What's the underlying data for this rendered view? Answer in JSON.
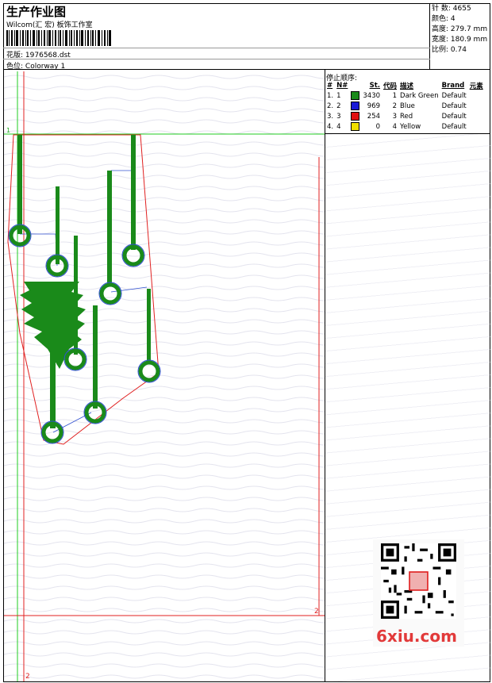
{
  "header": {
    "title": "生产作业图",
    "company": "Wilcom(汇 宏) 板饰工作室",
    "design_label": "花版:",
    "design_value": "1976568.dst",
    "colorway_label": "色位:",
    "colorway_value": "Colorway 1"
  },
  "specs": [
    {
      "label": "针 数:",
      "value": "4655"
    },
    {
      "label": "颜色:",
      "value": "4"
    },
    {
      "label": "高度:",
      "value": "279.7 mm"
    },
    {
      "label": "宽度:",
      "value": "180.9 mm"
    },
    {
      "label": "比例:",
      "value": "0.74"
    }
  ],
  "stop_sequence": {
    "title": "停止顺序:",
    "headers": [
      "#",
      "N#",
      "St.",
      "代码",
      "描述",
      "Brand",
      "元素"
    ],
    "rows": [
      {
        "index": "1.",
        "n": "1",
        "color": "#1a8a1a",
        "stitches": "3430",
        "code": "1",
        "desc": "Dark Green",
        "brand": "Default"
      },
      {
        "index": "2.",
        "n": "2",
        "color": "#1a1ad6",
        "stitches": "969",
        "code": "2",
        "desc": "Blue",
        "brand": "Default"
      },
      {
        "index": "3.",
        "n": "3",
        "color": "#e01010",
        "stitches": "254",
        "code": "3",
        "desc": "Red",
        "brand": "Default"
      },
      {
        "index": "4.",
        "n": "4",
        "color": "#f0e000",
        "stitches": "0",
        "code": "4",
        "desc": "Yellow",
        "brand": "Default"
      }
    ]
  },
  "markers": {
    "top_green": "1",
    "right_red": "2",
    "bottom_red": "2"
  },
  "watermark": {
    "site": "6xiu.com"
  },
  "colors": {
    "green_guide": "#22cc22",
    "red_guide": "#e02020",
    "stitch_green": "#1a8a1a",
    "stitch_blue": "#2040d0"
  }
}
